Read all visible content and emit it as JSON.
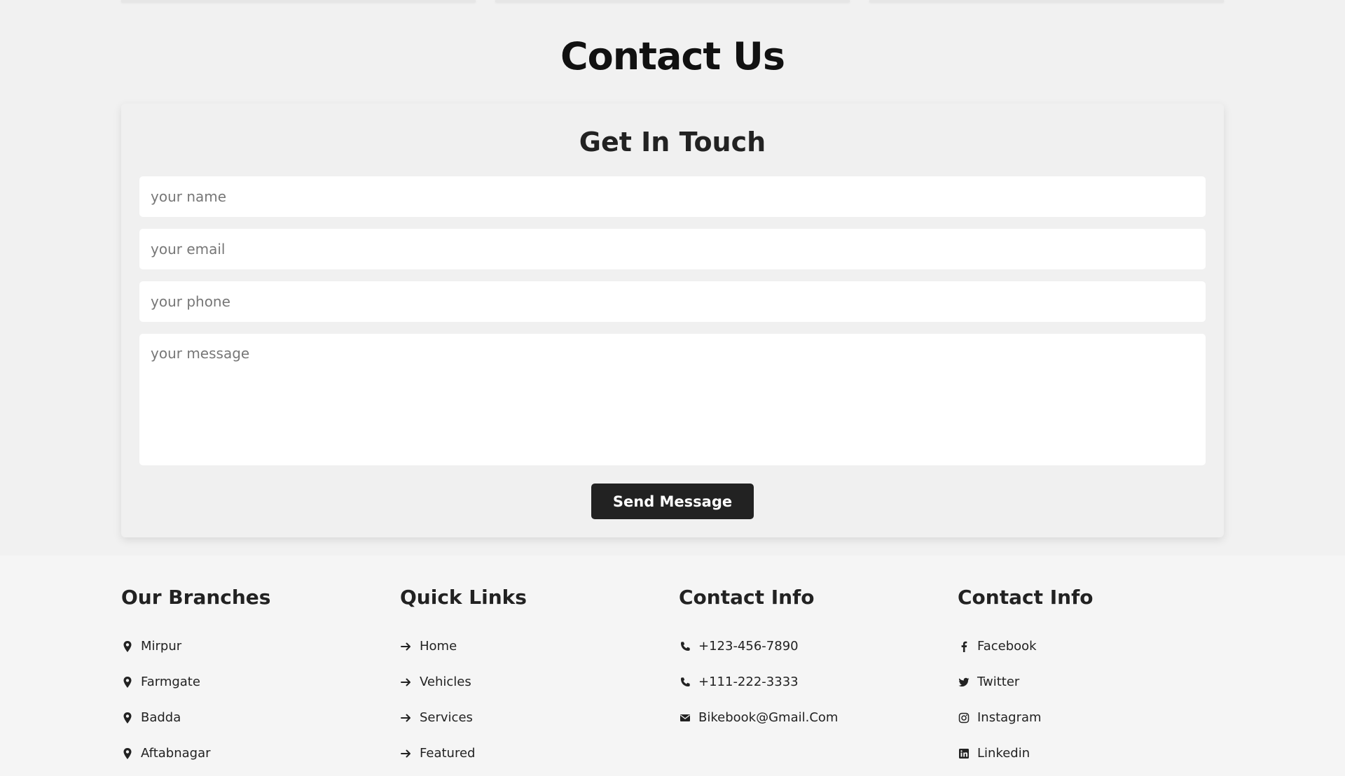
{
  "page": {
    "title_part1": "Contact",
    "title_part2": "Us"
  },
  "form": {
    "title": "Get In Touch",
    "name_placeholder": "your name",
    "email_placeholder": "your email",
    "phone_placeholder": "your phone",
    "message_placeholder": "your message",
    "submit_label": "Send Message"
  },
  "footer": {
    "branches": {
      "title": "Our Branches",
      "items": [
        "Mirpur",
        "Farmgate",
        "Badda",
        "Aftabnagar"
      ]
    },
    "quick_links": {
      "title": "Quick Links",
      "items": [
        "Home",
        "Vehicles",
        "Services",
        "Featured"
      ]
    },
    "contact_info": {
      "title": "Contact Info",
      "items": [
        {
          "icon": "phone-icon",
          "text": "+123-456-7890"
        },
        {
          "icon": "phone-icon",
          "text": "+111-222-3333"
        },
        {
          "icon": "envelope-icon",
          "text": "Bikebook@Gmail.Com"
        }
      ]
    },
    "social": {
      "title": "Contact Info",
      "items": [
        {
          "icon": "facebook-icon",
          "text": "Facebook"
        },
        {
          "icon": "twitter-icon",
          "text": "Twitter"
        },
        {
          "icon": "instagram-icon",
          "text": "Instagram"
        },
        {
          "icon": "linkedin-icon",
          "text": "Linkedin"
        }
      ]
    }
  },
  "colors": {
    "accent": "#ff6b00",
    "button_bg": "#222222",
    "page_bg": "#f1f1f1"
  }
}
